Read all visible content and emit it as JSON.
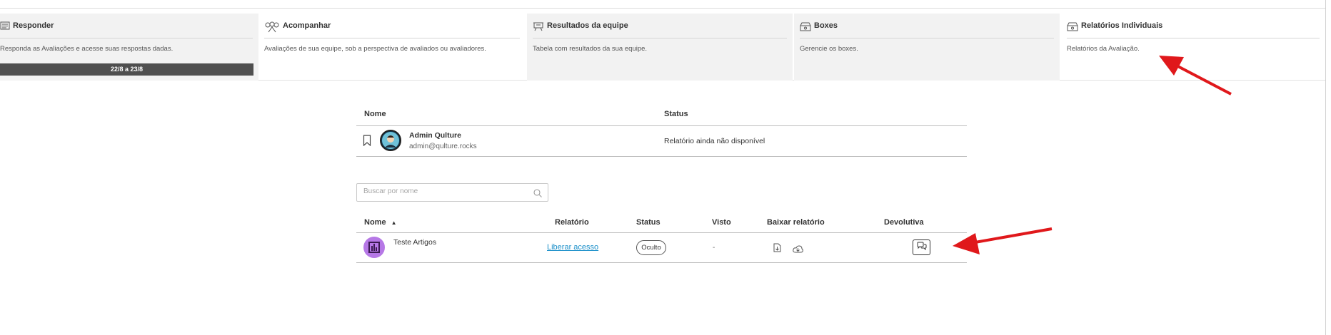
{
  "cards": [
    {
      "title": "Responder",
      "icon": "list-icon",
      "desc": "Responda as Avaliações e acesse suas respostas dadas.",
      "bar": "22/8 a 23/8"
    },
    {
      "title": "Acompanhar",
      "icon": "people-icon",
      "desc": "Avaliações de sua equipe, sob a perspectiva de avaliados ou avaliadores."
    },
    {
      "title": "Resultados da equipe",
      "icon": "presentation-icon",
      "desc": "Tabela com resultados da sua equipe."
    },
    {
      "title": "Boxes",
      "icon": "box-icon",
      "desc": "Gerencie os boxes."
    },
    {
      "title": "Relatórios Individuais",
      "icon": "box-icon",
      "desc": "Relatórios da Avaliação."
    }
  ],
  "own_table": {
    "headers": {
      "name": "Nome",
      "status": "Status"
    },
    "row": {
      "name": "Admin Qulture",
      "email": "admin@qulture.rocks",
      "status": "Relatório ainda não disponível"
    }
  },
  "search": {
    "placeholder": "Buscar por nome"
  },
  "team_table": {
    "headers": {
      "name": "Nome",
      "report": "Relatório",
      "status": "Status",
      "seen": "Visto",
      "download": "Baixar relatório",
      "feedback": "Devolutiva"
    },
    "rows": [
      {
        "name": "Teste Artigos",
        "report_link": "Liberar acesso",
        "status": "Oculto",
        "seen": "-"
      }
    ]
  },
  "colors": {
    "accent": "#1a8fc9",
    "bar": "#4f4f4f",
    "avatar_purple": "#b678e6",
    "arrow": "#e0181b"
  }
}
